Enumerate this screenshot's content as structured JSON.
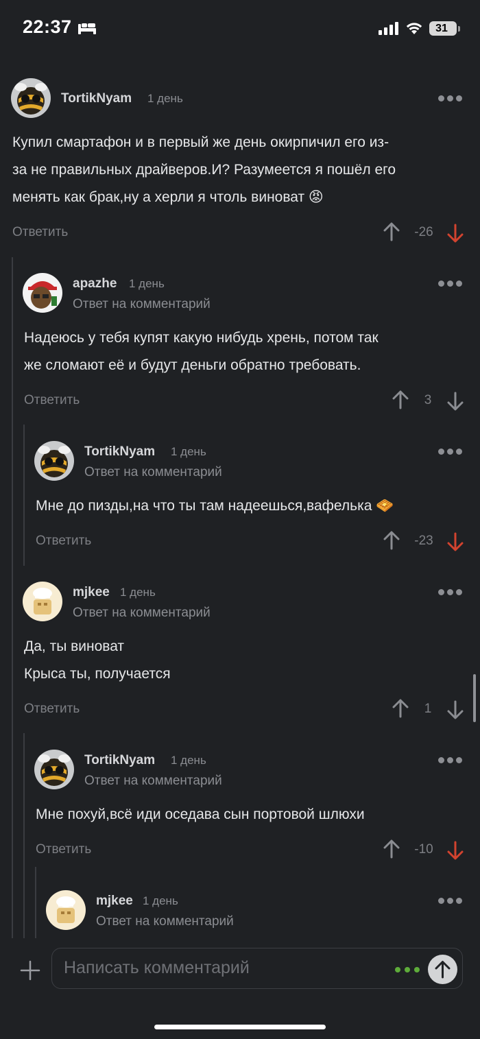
{
  "status_bar": {
    "time": "22:37",
    "battery": "31"
  },
  "comments": [
    {
      "username": "TortikNyam",
      "time": "1 день",
      "avatar": "bee-avatar",
      "text": [
        "Купил смартафон и в первый же день окирпичил его из-",
        "за не правильных драйверов.И? Разумеется я пошёл его",
        "менять как брак,ну а херли я чтоль виноват 😡"
      ],
      "reply_label": "Ответить",
      "score": "-26",
      "vote": "down"
    },
    {
      "username": "apazhe",
      "time": "1 день",
      "avatar": "cap-character-avatar",
      "reply_to": "Ответ на комментарий",
      "text": [
        "Надеюсь у тебя купят какую нибудь хрень, потом так",
        "же сломают её и будут деньги обратно требовать."
      ],
      "reply_label": "Ответить",
      "score": "3",
      "vote": "none"
    },
    {
      "username": "TortikNyam",
      "time": "1 день",
      "avatar": "bee-avatar",
      "reply_to": "Ответ на комментарий",
      "text": [
        "Мне до пизды,на что ты там надеешься,вафелька 🧇"
      ],
      "reply_label": "Ответить",
      "score": "-23",
      "vote": "down"
    },
    {
      "username": "mjkee",
      "time": "1 день",
      "avatar": "chef-avatar",
      "reply_to": "Ответ на комментарий",
      "text": [
        "Да, ты виноват",
        "Крыса ты, получается"
      ],
      "reply_label": "Ответить",
      "score": "1",
      "vote": "none"
    },
    {
      "username": "TortikNyam",
      "time": "1 день",
      "avatar": "bee-avatar",
      "reply_to": "Ответ на комментарий",
      "text": [
        "Мне похуй,всё иди оседава сын портовой шлюхи"
      ],
      "reply_label": "Ответить",
      "score": "-10",
      "vote": "down"
    },
    {
      "username": "mjkee",
      "time": "1 день",
      "avatar": "chef-avatar",
      "reply_to": "Ответ на комментарий"
    }
  ],
  "composer": {
    "placeholder": "Написать комментарий"
  },
  "colors": {
    "background": "#1f2124",
    "downvote_active": "#d2432f",
    "muted": "#8b8d92",
    "typing_dots": "#5eac3a"
  }
}
